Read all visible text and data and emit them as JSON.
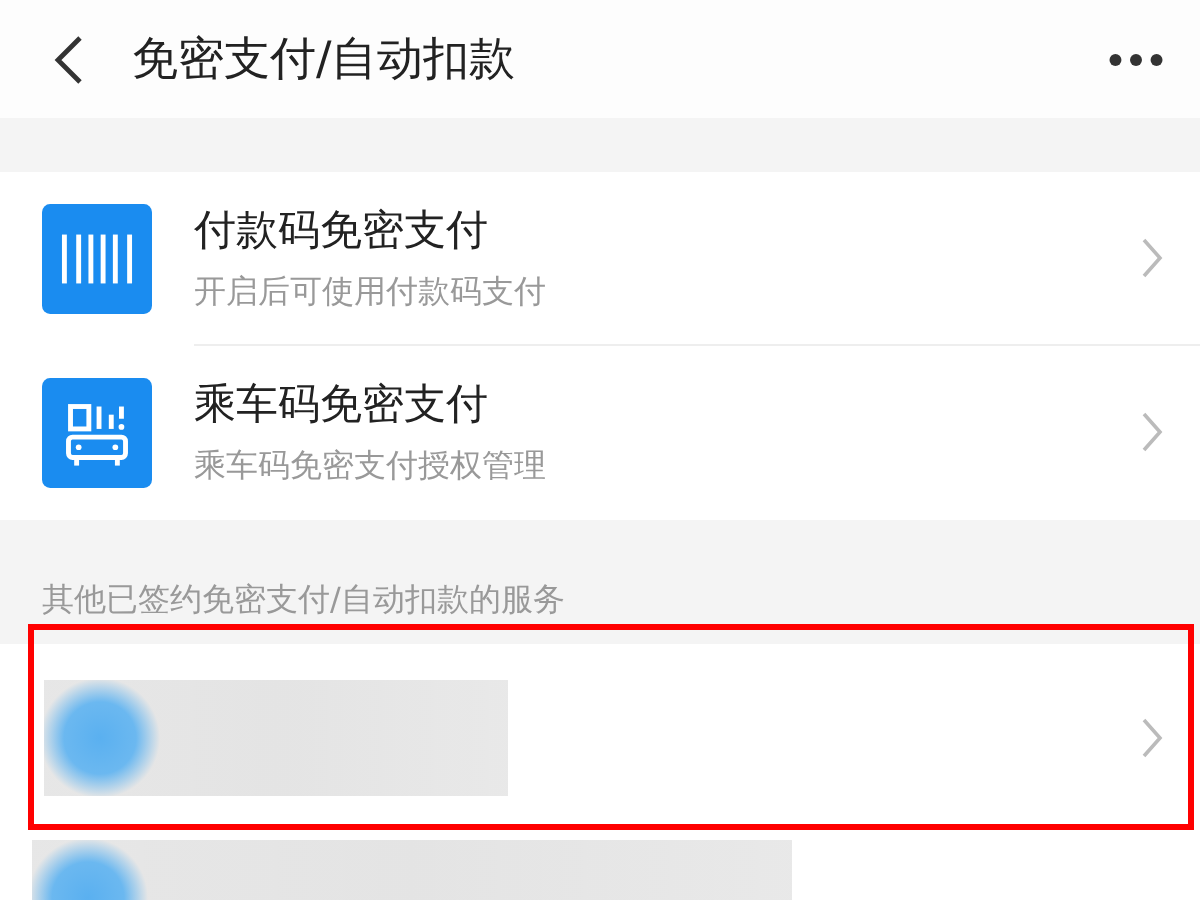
{
  "header": {
    "title": "免密支付/自动扣款"
  },
  "services": [
    {
      "kind": "barcode",
      "title": "付款码免密支付",
      "subtitle": "开启后可使用付款码支付"
    },
    {
      "kind": "transit",
      "title": "乘车码免密支付",
      "subtitle": "乘车码免密支付授权管理"
    }
  ],
  "other_section": {
    "label": "其他已签约免密支付/自动扣款的服务",
    "items": [
      {
        "kind": "redacted",
        "highlighted": true
      },
      {
        "kind": "redacted",
        "highlighted": false
      }
    ]
  }
}
